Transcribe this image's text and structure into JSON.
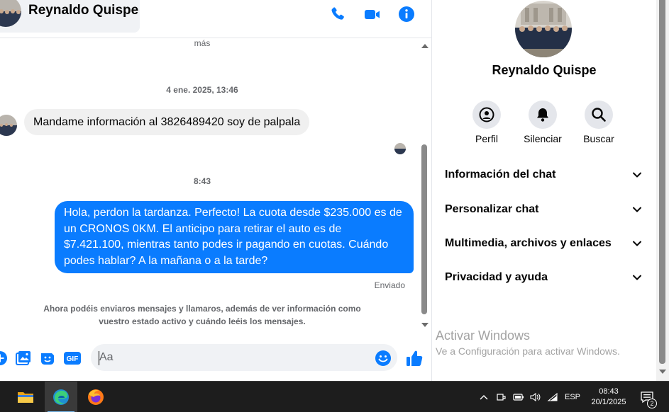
{
  "colors": {
    "accent": "#0a7cff",
    "incoming_bubble": "#f0f0f0",
    "muted_text": "#65676b",
    "taskbar": "#1d1d1d"
  },
  "header": {
    "contact_name": "Reynaldo Quispe",
    "icons": [
      "phone-icon",
      "video-camera-icon",
      "info-icon"
    ]
  },
  "messages": {
    "more_label": "más",
    "timestamp_1": "4 ene. 2025, 13:46",
    "incoming_text": "Mandame información al 3826489420 soy de palpala",
    "timestamp_2": "8:43",
    "outgoing_text": "Hola, perdon la tardanza. Perfecto! La cuota desde $235.000 es de un CRONOS 0KM. El anticipo para retirar el auto es de $7.421.100, mientras tanto podes ir pagando en cuotas. Cuándo podes hablar? A la mañana o a la tarde?",
    "status": "Enviado",
    "notice": "Ahora podéis enviaros mensajes y llamaros, además de ver información como vuestro estado activo y cuándo leéis los mensajes."
  },
  "composer": {
    "placeholder": "Aa",
    "gif_label": "GIF",
    "icons": [
      "plus-circle-icon",
      "image-icon",
      "sticker-icon",
      "gif-icon",
      "emoji-icon",
      "thumbs-up-icon"
    ]
  },
  "info_panel": {
    "name": "Reynaldo Quispe",
    "actions": [
      {
        "label": "Perfil",
        "icon": "profile-icon"
      },
      {
        "label": "Silenciar",
        "icon": "bell-icon"
      },
      {
        "label": "Buscar",
        "icon": "search-icon"
      }
    ],
    "sections": [
      {
        "title": "Información del chat"
      },
      {
        "title": "Personalizar chat"
      },
      {
        "title": "Multimedia, archivos y enlaces"
      },
      {
        "title": "Privacidad y ayuda"
      }
    ],
    "watermark_title": "Activar Windows",
    "watermark_sub": "Ve a Configuración para activar Windows."
  },
  "taskbar": {
    "apps": [
      "file-explorer-icon",
      "edge-icon",
      "firefox-icon"
    ],
    "language": "ESP",
    "time": "08:43",
    "date": "20/1/2025",
    "notification_count": "2"
  }
}
